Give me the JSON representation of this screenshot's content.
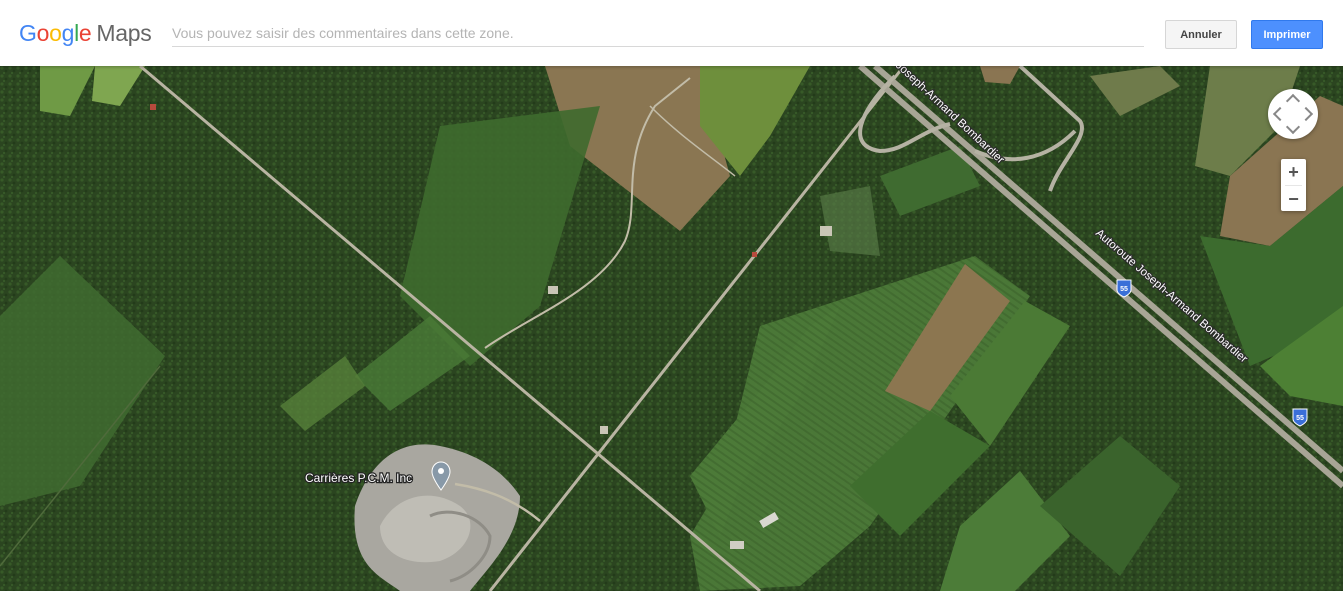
{
  "header": {
    "logo_google": [
      "G",
      "o",
      "o",
      "g",
      "l",
      "e"
    ],
    "logo_maps": "Maps",
    "comment_placeholder": "Vous pouvez saisir des commentaires dans cette zone.",
    "cancel_label": "Annuler",
    "print_label": "Imprimer"
  },
  "map": {
    "place_label": "Carrières P.C.M. Inc",
    "highway_label_1": "Autoroute Joseph-Armand Bombardier",
    "highway_label_2": "Autoroute Joseph-Armand Bombardier",
    "highway_label_3": "Joseph-Armand Bombardier",
    "shield_1": "55",
    "shield_2": "55",
    "imagery_base_color": "#2c4620"
  },
  "controls": {
    "zoom_in": "+",
    "zoom_out": "−"
  },
  "colors": {
    "print_button": "#4d90fe",
    "highway_shield": "#3a6fd8"
  }
}
